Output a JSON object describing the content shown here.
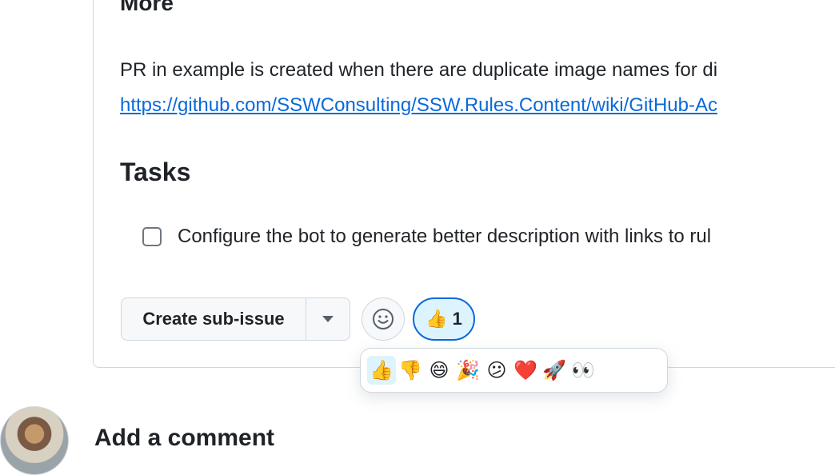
{
  "content": {
    "heading_more": "More",
    "paragraph": "PR in example is created when there are duplicate image names for di",
    "link_text": "https://github.com/SSWConsulting/SSW.Rules.Content/wiki/GitHub-Ac",
    "heading_tasks": "Tasks",
    "task_label": "Configure the bot to generate better description with links to rul"
  },
  "actions": {
    "create_sub_issue": "Create sub-issue",
    "reaction": {
      "emoji": "👍",
      "count": "1"
    }
  },
  "emoji_picker": {
    "items": [
      "👍",
      "👎",
      "😄",
      "🎉",
      "😕",
      "❤️",
      "🚀",
      "👀"
    ]
  },
  "comment": {
    "title": "Add a comment"
  }
}
